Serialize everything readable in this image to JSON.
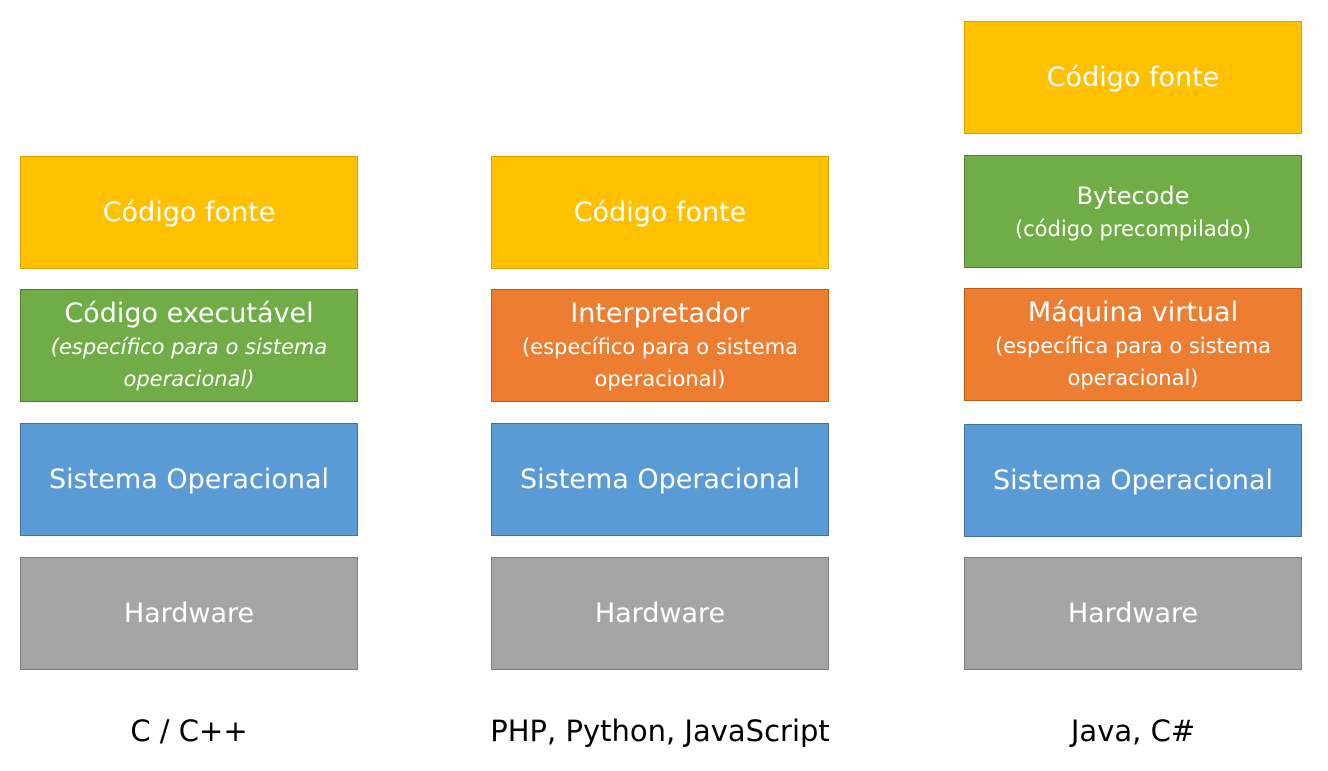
{
  "columns": [
    {
      "caption": "C / C++",
      "code": "Código fonte",
      "middle_title": "Código executável",
      "middle_sub_1": "(específico para o sistema",
      "middle_sub_2": "operacional)",
      "os": "Sistema Operacional",
      "hardware": "Hardware"
    },
    {
      "caption": "PHP, Python, JavaScript",
      "code": "Código fonte",
      "middle_title": "Interpretador",
      "middle_sub_1": "(específico para o sistema",
      "middle_sub_2": "operacional)",
      "os": "Sistema Operacional",
      "hardware": "Hardware"
    },
    {
      "caption": "Java, C#",
      "code": "Código fonte",
      "bytecode_title": "Bytecode",
      "bytecode_sub": "(código precompilado)",
      "middle_title": "Máquina virtual",
      "middle_sub_1": "(específica para o sistema",
      "middle_sub_2": "operacional)",
      "os": "Sistema Operacional",
      "hardware": "Hardware"
    }
  ]
}
